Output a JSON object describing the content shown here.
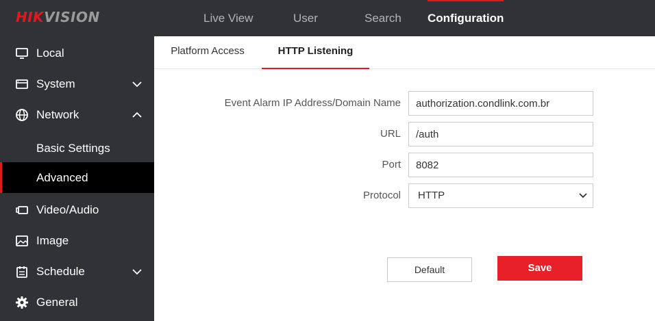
{
  "brand": {
    "logo_part1": "HIK",
    "logo_part2": "VISION"
  },
  "topnav": [
    {
      "label": "Live View"
    },
    {
      "label": "User"
    },
    {
      "label": "Search"
    },
    {
      "label": "Configuration",
      "active": true
    }
  ],
  "sidebar": {
    "items": [
      {
        "label": "Local",
        "icon": "monitor-icon"
      },
      {
        "label": "System",
        "icon": "system-icon",
        "expanded": false
      },
      {
        "label": "Network",
        "icon": "globe-icon",
        "expanded": true
      },
      {
        "label": "Basic Settings",
        "sub": true
      },
      {
        "label": "Advanced",
        "sub": true,
        "active": true
      },
      {
        "label": "Video/Audio",
        "icon": "video-icon"
      },
      {
        "label": "Image",
        "icon": "image-icon"
      },
      {
        "label": "Schedule",
        "icon": "calendar-icon",
        "expanded": false
      },
      {
        "label": "General",
        "icon": "gear-icon"
      }
    ]
  },
  "tabs": [
    {
      "label": "Platform Access"
    },
    {
      "label": "HTTP Listening",
      "active": true
    }
  ],
  "form": {
    "event_alarm_label": "Event Alarm IP Address/Domain Name",
    "event_alarm_value": "authorization.condlink.com.br",
    "url_label": "URL",
    "url_value": "/auth",
    "port_label": "Port",
    "port_value": "8082",
    "protocol_label": "Protocol",
    "protocol_value": "HTTP"
  },
  "buttons": {
    "default_label": "Default",
    "save_label": "Save"
  },
  "colors": {
    "accent": "#e0181f",
    "dark_bg": "#303236",
    "active_bg": "#000000",
    "save": "#e8202a"
  }
}
